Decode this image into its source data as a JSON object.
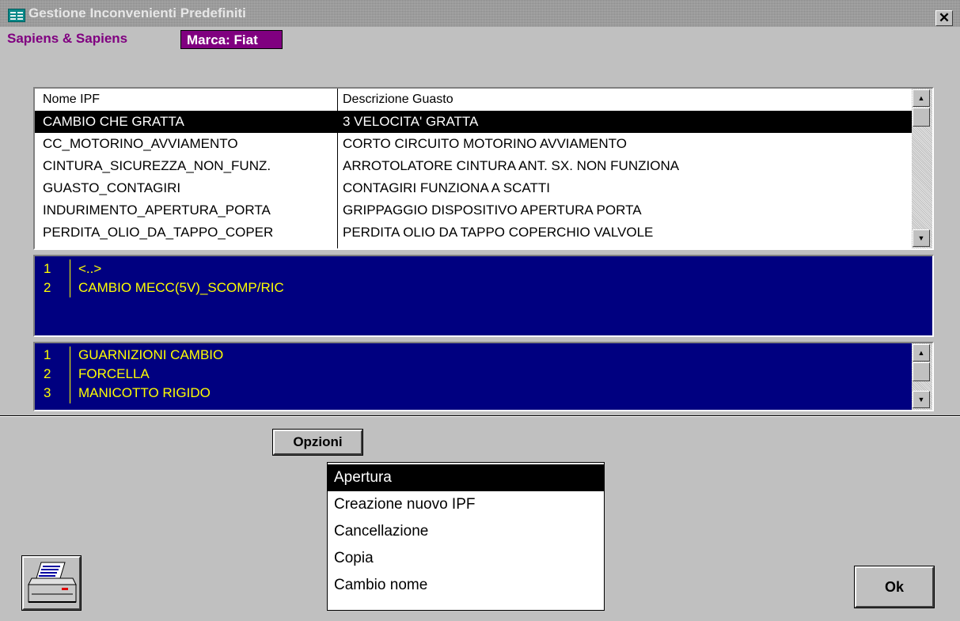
{
  "window": {
    "title": "Gestione Inconvenienti Predefiniti",
    "close_icon": "close-icon",
    "app_icon": "form-icon"
  },
  "header": {
    "company": "Sapiens & Sapiens",
    "brand": "Marca: Fiat"
  },
  "ipf_table": {
    "columns": [
      "Nome IPF",
      "Descrizione Guasto"
    ],
    "rows": [
      {
        "name": "CAMBIO CHE GRATTA",
        "desc": "3 VELOCITA' GRATTA",
        "selected": true
      },
      {
        "name": "CC_MOTORINO_AVVIAMENTO",
        "desc": "CORTO CIRCUITO MOTORINO AVVIAMENTO"
      },
      {
        "name": "CINTURA_SICUREZZA_NON_FUNZ.",
        "desc": "ARROTOLATORE CINTURA  ANT. SX. NON FUNZIONA"
      },
      {
        "name": "GUASTO_CONTAGIRI",
        "desc": "CONTAGIRI FUNZIONA A SCATTI"
      },
      {
        "name": "INDURIMENTO_APERTURA_PORTA",
        "desc": "GRIPPAGGIO DISPOSITIVO APERTURA PORTA"
      },
      {
        "name": "PERDITA_OLIO_DA_TAPPO_COPER",
        "desc": "PERDITA OLIO DA TAPPO COPERCHIO VALVOLE"
      }
    ]
  },
  "groups_list": {
    "items": [
      {
        "num": "1",
        "text": "<..>"
      },
      {
        "num": "2",
        "text": "CAMBIO MECC(5V)_SCOMP/RIC"
      }
    ]
  },
  "parts_list": {
    "items": [
      {
        "num": "1",
        "text": "GUARNIZIONI CAMBIO"
      },
      {
        "num": "2",
        "text": "FORCELLA"
      },
      {
        "num": "3",
        "text": "MANICOTTO RIGIDO"
      }
    ]
  },
  "options": {
    "button_label": "Opzioni",
    "menu_items": [
      {
        "label": "Apertura",
        "active": true
      },
      {
        "label": "Creazione nuovo IPF"
      },
      {
        "label": "Cancellazione"
      },
      {
        "label": "Copia"
      },
      {
        "label": "Cambio nome"
      }
    ]
  },
  "footer": {
    "ok_label": "Ok",
    "print_icon": "printer-icon"
  },
  "colors": {
    "brand_bg": "#800080",
    "list_bg": "#000080",
    "list_text": "#ffff00"
  }
}
